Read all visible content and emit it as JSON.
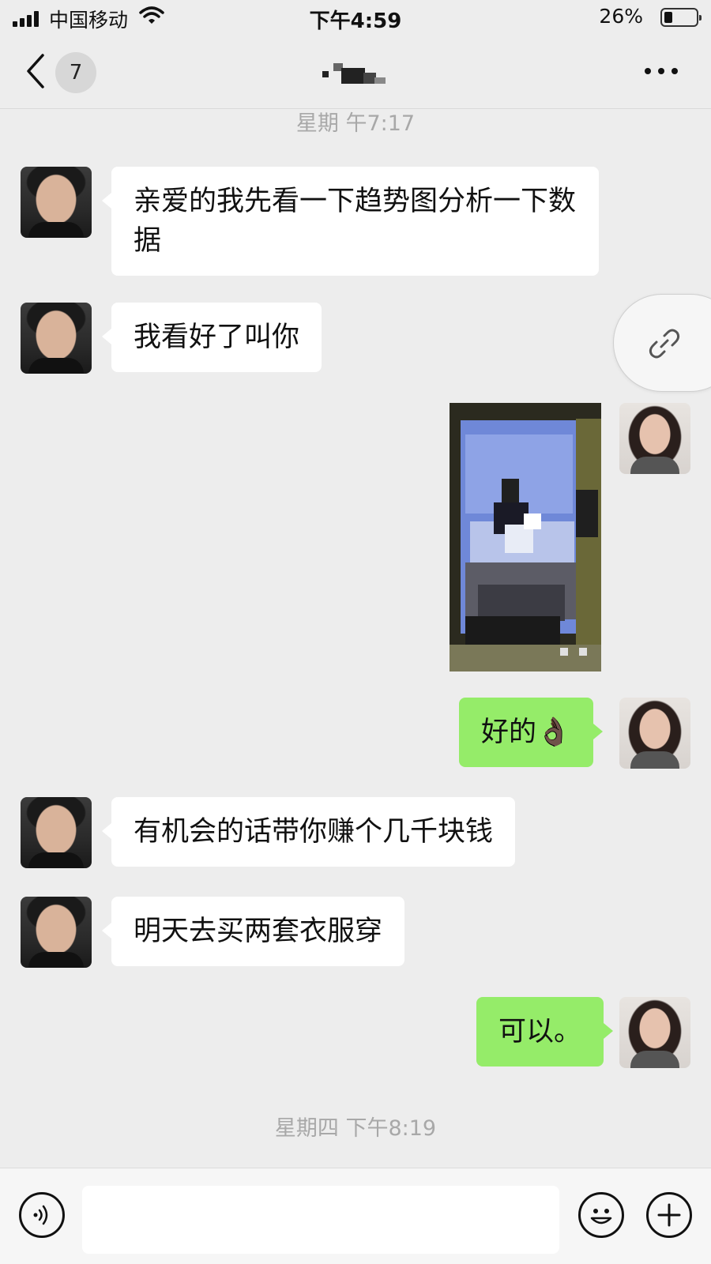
{
  "status_bar": {
    "carrier": "中国移动",
    "time": "下午4:59",
    "battery_percent": "26%",
    "battery_level": 0.26
  },
  "nav": {
    "unread_count": "7",
    "title_censored": true
  },
  "timestamps": {
    "first": "星期    午7:17",
    "second": "星期四 下午8:19"
  },
  "messages": [
    {
      "side": "left",
      "text": "亲爱的我先看一下趋势图分析一下数据"
    },
    {
      "side": "left",
      "text": "我看好了叫你"
    },
    {
      "side": "right",
      "type": "image",
      "content": "pixelated-photo"
    },
    {
      "side": "right",
      "text": "好的👌🏿"
    },
    {
      "side": "left",
      "text": "有机会的话带你赚个几千块钱"
    },
    {
      "side": "left",
      "text": "明天去买两套衣服穿"
    },
    {
      "side": "right",
      "text": "可以。"
    }
  ],
  "icons": {
    "back": "chevron-left-icon",
    "more": "more-dots-icon",
    "link": "link-icon",
    "voice": "voice-icon",
    "emoji": "emoji-icon",
    "plus": "plus-icon"
  },
  "colors": {
    "background": "#ededed",
    "sent_bubble": "#95ec69",
    "received_bubble": "#ffffff",
    "timestamp": "#a8a8a8"
  },
  "input": {
    "value": "",
    "placeholder": ""
  }
}
